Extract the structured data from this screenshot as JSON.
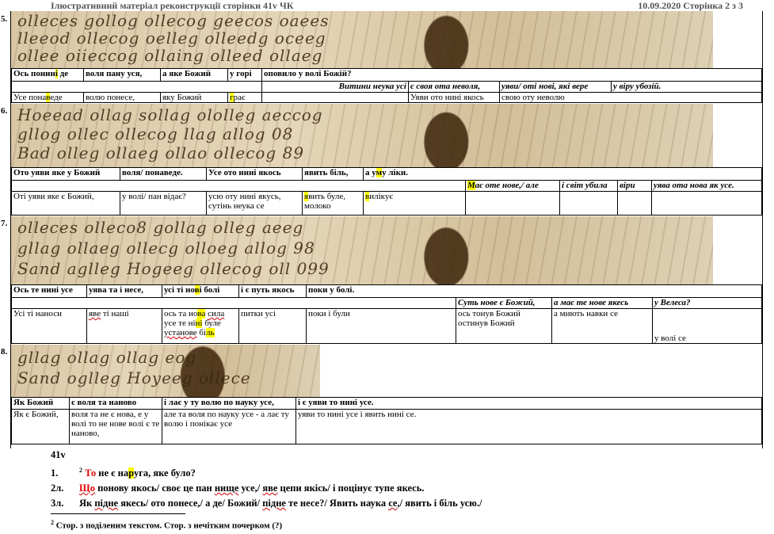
{
  "header": {
    "left": "Ілюстративний матеріал  реконструкції сторінки 41v ЧК",
    "right": "10.09.2020  Сторінка 2 з 3"
  },
  "scan_glyphs": {
    "row5": [
      "olleces gollog ollecog geecos oaees",
      "lleeod ollecog oelleg olleedg oceeg",
      "ollee oiieccog ollaing olleed ollaeg"
    ],
    "row6": [
      "Hoeead ollag sollag ololleg aeccog",
      "gllog ollec ollecog llag allog 08",
      "Bad olleg ollaeg ollao ollecog 89"
    ],
    "row7": [
      "olleces olleco8 gollag olleg aeeg",
      "gllag ollaeg ollecg olloeg allog 98",
      "Sand aglleg Hogeeg ollecog oll 099"
    ],
    "row8": [
      "gllag ollag ollag eog",
      "Sand oglleg Hoyeeg ollece"
    ]
  },
  "sections": [
    {
      "num": "5.",
      "r1": [
        "Ось понині де",
        "воля пану уся,",
        "а яке Божий",
        "у горі",
        "оповило у волі Божій?"
      ],
      "r2": [
        "Витини неука усі",
        "є  своя ота неволя,",
        "уяви/ оті нові, які вере",
        "у віру убозій."
      ],
      "r3": [
        "Усе понаведе",
        "волю понесе,",
        "яку Божий",
        "грає",
        "",
        "Уяви ото нині якось",
        "свою оту неволю"
      ]
    },
    {
      "num": "6.",
      "r1": [
        "Ото уяви яке у Божий",
        "воля/ понаведе.",
        "Усе ото нині якось",
        "явить біль,",
        "а уму ліки."
      ],
      "r2": [
        "Має оте нове,/ але",
        "і світ убила",
        "віри",
        "уява ота нова як усе."
      ],
      "r3": [
        "Оті уяви яке є Божий,",
        "у волі/ пан відає?",
        "усю оту нині якусь, сутінь неука се",
        "явить буле, молоко",
        "вилікує"
      ]
    },
    {
      "num": "7.",
      "r1": [
        "Ось те нині усе",
        "уява та і несе,",
        "усі ті нові болі",
        "і є путь якось",
        "поки у болі."
      ],
      "r2": [
        "Суть нове є Божий,",
        "а має те нове якесь",
        "у Велеса?"
      ],
      "r3": [
        "Усі ті наноси",
        "яве ті наші",
        "ось та нова сила усе те нині буле установе біль",
        "питки усі",
        "поки і були",
        "ось тонув Божий остинув Божий",
        "а миють навки се",
        "у волі се"
      ]
    },
    {
      "num": "8.",
      "r1": [
        "Як Божий",
        "є воля та наново",
        "і лає у ту волю по науку усе,",
        "і є уяви то нині усе."
      ],
      "r3": [
        "Як є Божий,",
        "воля та не є нова, е у волі то не нове волі є те наново,",
        "але та воля по науку усе - а лає ту волю і понікає усе",
        "уяви то нині усе і явить нині се."
      ]
    }
  ],
  "notes": {
    "title": "41v",
    "lines": [
      {
        "n": "1.",
        "sup": "2",
        "red": "То",
        "rest": " не є наруга, яке було?"
      },
      {
        "n": "2л.",
        "red": "Що",
        "rest": " понову якось/ своє це пан нище усе,/ яве цепи якісь/ і поцінує тупе якесь."
      },
      {
        "n": "3л.",
        "rest": "Як підне якесь/ ото понесе,/ а де/ Божий/ підне те несе?/ Явить наука се,/ явить і біль усю./"
      }
    ]
  },
  "footnote": {
    "sup": "2",
    "text": " Стор. з поділеним текстом. Стор. з нечітким почерком (?)"
  }
}
